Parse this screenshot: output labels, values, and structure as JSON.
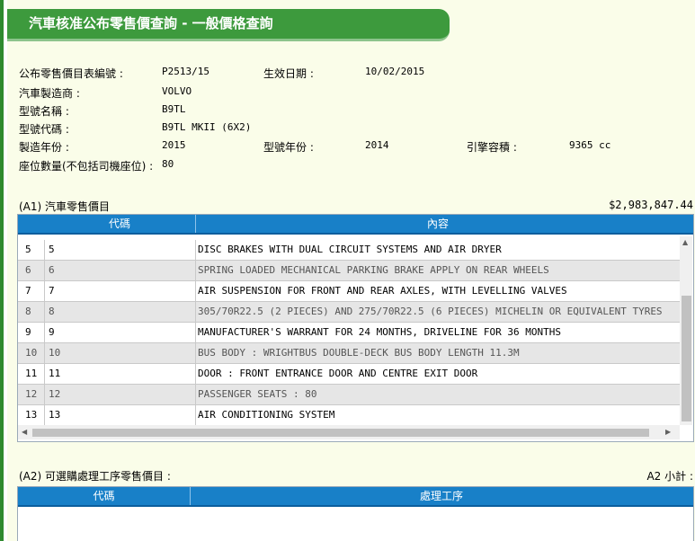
{
  "header": {
    "title": "汽車核准公布零售價查詢 - 一般價格查詢"
  },
  "info": {
    "list_no_label": "公布零售價目表編號 :",
    "list_no_value": "P2513/15",
    "effective_date_label": "生效日期 :",
    "effective_date_value": "10/02/2015",
    "maker_label": "汽車製造商 :",
    "maker_value": "VOLVO",
    "model_name_label": "型號名稱 :",
    "model_name_value": "B9TL",
    "model_code_label": "型號代碼 :",
    "model_code_value": "B9TL MKII (6X2)",
    "year_made_label": "製造年份 :",
    "year_made_value": "2015",
    "model_year_label": "型號年份 :",
    "model_year_value": "2014",
    "engine_label": "引擎容積 :",
    "engine_value": "9365 cc",
    "seats_label": "座位數量(不包括司機座位) :",
    "seats_value": "80"
  },
  "section_a1": {
    "label": "(A1) 汽車零售價目",
    "total": "$2,983,847.44",
    "col_code": "代碼",
    "col_content": "內容",
    "rows": [
      {
        "no": "5",
        "code": "5",
        "content": "DISC BRAKES WITH DUAL CIRCUIT SYSTEMS AND AIR DRYER"
      },
      {
        "no": "6",
        "code": "6",
        "content": "SPRING LOADED MECHANICAL PARKING BRAKE APPLY ON REAR WHEELS"
      },
      {
        "no": "7",
        "code": "7",
        "content": "AIR SUSPENSION FOR FRONT AND REAR AXLES, WITH LEVELLING VALVES"
      },
      {
        "no": "8",
        "code": "8",
        "content": "305/70R22.5 (2 PIECES) AND 275/70R22.5 (6 PIECES) MICHELIN OR EQUIVALENT TYRES"
      },
      {
        "no": "9",
        "code": "9",
        "content": "MANUFACTURER'S WARRANT FOR 24 MONTHS, DRIVELINE FOR 36 MONTHS"
      },
      {
        "no": "10",
        "code": "10",
        "content": "BUS BODY : WRIGHTBUS DOUBLE-DECK BUS BODY LENGTH 11.3M"
      },
      {
        "no": "11",
        "code": "11",
        "content": "DOOR : FRONT ENTRANCE DOOR AND CENTRE EXIT DOOR"
      },
      {
        "no": "12",
        "code": "12",
        "content": "PASSENGER SEATS : 80"
      },
      {
        "no": "13",
        "code": "13",
        "content": "AIR CONDITIONING SYSTEM"
      }
    ]
  },
  "section_a2": {
    "label": "(A2) 可選購處理工序零售價目 :",
    "subtotal_label": "A2 小計 :",
    "col_code": "代碼",
    "col_process": "處理工序"
  }
}
